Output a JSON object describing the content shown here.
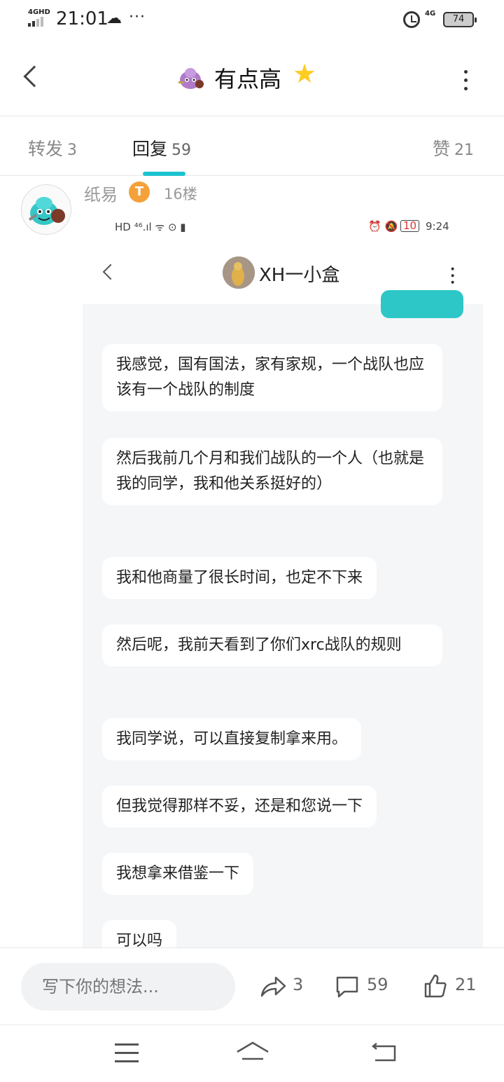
{
  "status_bar": {
    "network": "4GHD",
    "time": "21:01",
    "cloud_icon": "cloud-icon",
    "more": "···",
    "network_right": "4G",
    "battery": "74"
  },
  "header": {
    "title": "有点高",
    "star_icon": "star-icon"
  },
  "tabs": [
    {
      "label": "转发",
      "count": "3"
    },
    {
      "label": "回复",
      "count": "59"
    },
    {
      "label": "赞",
      "count": "21"
    }
  ],
  "post": {
    "username": "纸易",
    "badge": "T",
    "floor": "16楼"
  },
  "screenshot": {
    "status_left": "HD ⁴⁶.ıl ᯤ ⊙ ▮",
    "battery": "10",
    "time": "9:24",
    "chat_title": "XH一小盒",
    "messages": [
      "我感觉，国有国法，家有家规，一个战队也应该有一个战队的制度",
      "然后我前几个月和我们战队的一个人（也就是我的同学，我和他关系挺好的）",
      "我和他商量了很长时间，也定不下来",
      "然后呢，我前天看到了你们xrc战队的规则",
      "我同学说，可以直接复制拿来用。",
      "但我觉得那样不妥，还是和您说一下",
      "我想拿来借鉴一下",
      "可以吗"
    ]
  },
  "bottom_bar": {
    "comment_placeholder": "写下你的想法...",
    "share_count": "3",
    "comment_count": "59",
    "like_count": "21"
  },
  "colors": {
    "accent": "#1cc3cf",
    "chat_background": "#f4f6f8",
    "sent_bubble": "#2ec7c8"
  }
}
